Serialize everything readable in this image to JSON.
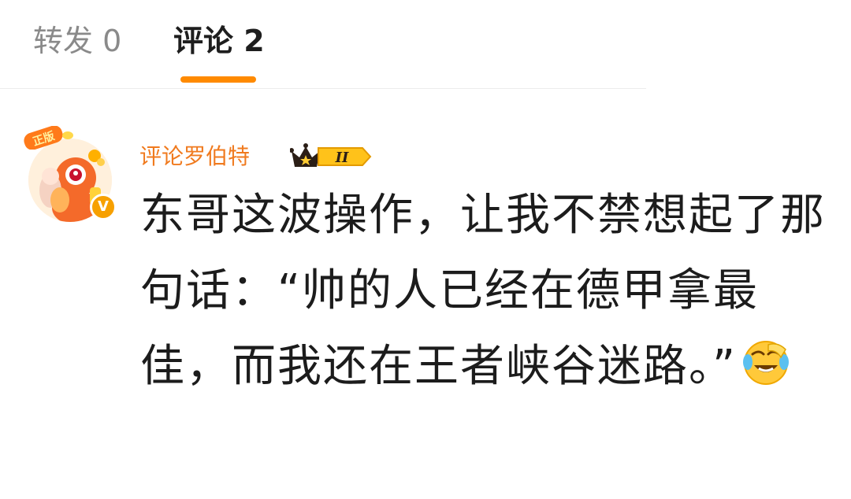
{
  "tabs": {
    "repost": "转发 0",
    "comments": "评论 2",
    "active": "comments"
  },
  "comment": {
    "avatar": {
      "tag_text": "正版",
      "verified_mark": "V"
    },
    "username": "评论罗伯特",
    "rank_badge": {
      "icon": "crown-icon",
      "level": "II"
    },
    "text": "东哥这波操作，让我不禁想起了那句话：“帅的人已经在德甲拿最佳，而我还在王者峡谷迷路。”",
    "emoji": "laugh-cry-emoji"
  },
  "colors": {
    "accent": "#ff8a00",
    "username": "#f07a1e",
    "inactive_tab": "#8a8a8a",
    "verified": "#f7a000"
  }
}
